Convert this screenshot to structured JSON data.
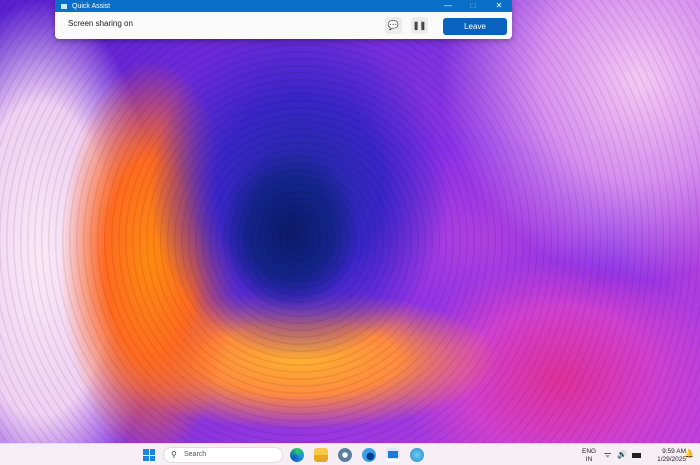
{
  "quick_assist": {
    "title": "Quick Assist",
    "status": "Screen sharing on",
    "leave_label": "Leave",
    "minimize": "—",
    "maximize": "□",
    "close": "✕"
  },
  "taskbar": {
    "search_placeholder": "Search",
    "language": "ENG",
    "region": "IN",
    "time": "9:59 AM",
    "date": "1/29/2025"
  },
  "colors": {
    "accent": "#0a6fc9",
    "leave": "#0a62c0"
  }
}
